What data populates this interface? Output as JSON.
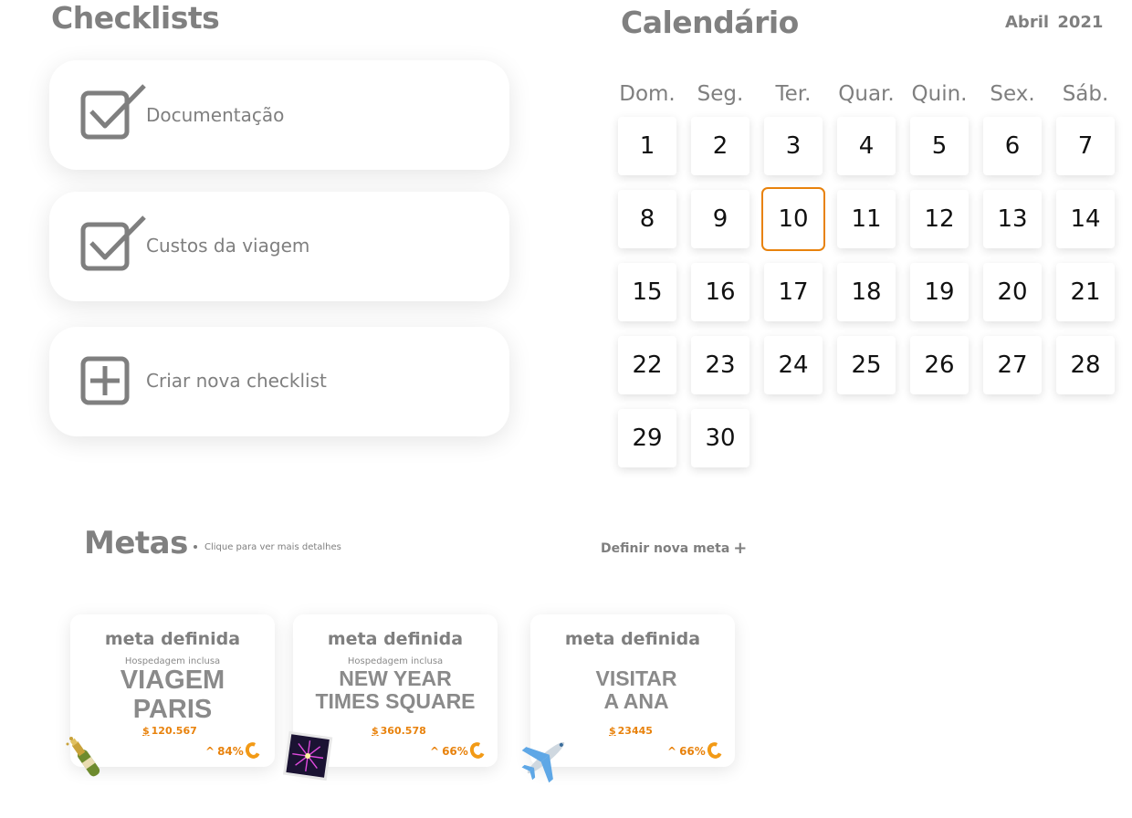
{
  "checklists": {
    "title": "Checklists",
    "items": [
      {
        "label": "Documentação",
        "icon": "checkbox-checked-icon"
      },
      {
        "label": "Custos da viagem",
        "icon": "checkbox-checked-icon"
      },
      {
        "label": "Criar nova checklist",
        "icon": "plus-square-icon"
      }
    ]
  },
  "calendar": {
    "title": "Calendário",
    "month": "Abril",
    "year": "2021",
    "weekdays": [
      "Dom.",
      "Seg.",
      "Ter.",
      "Quar.",
      "Quin.",
      "Sex.",
      "Sáb."
    ],
    "days": [
      "1",
      "2",
      "3",
      "4",
      "5",
      "6",
      "7",
      "8",
      "9",
      "10",
      "11",
      "12",
      "13",
      "14",
      "15",
      "16",
      "17",
      "18",
      "19",
      "20",
      "21",
      "22",
      "23",
      "24",
      "25",
      "26",
      "27",
      "28",
      "29",
      "30"
    ],
    "today": "10",
    "accent_color": "#e8820c"
  },
  "metas": {
    "title": "Metas",
    "hint": "Clique para ver mais detalhes",
    "new_goal_label": "Definir nova meta",
    "new_goal_icon": "plus-icon",
    "goals": [
      {
        "heading": "meta definida",
        "subtitle": "Hospedagem inclusa",
        "name_line1": "VIAGEM",
        "name_line2": "PARIS",
        "amount": "120.567",
        "progress": "84%",
        "emoji": "champagne-bottle-icon"
      },
      {
        "heading": "meta definida",
        "subtitle": "Hospedagem inclusa",
        "name_line1": "NEW YEAR",
        "name_line2": "TIMES SQUARE",
        "amount": "360.578",
        "progress": "66%",
        "emoji": "fireworks-icon"
      },
      {
        "heading": "meta definida",
        "subtitle": "",
        "name_line1": "VISITAR",
        "name_line2": "A ANA",
        "amount": "23445",
        "progress": "66%",
        "emoji": "airplane-icon"
      }
    ],
    "accent_color": "#e8820c"
  }
}
